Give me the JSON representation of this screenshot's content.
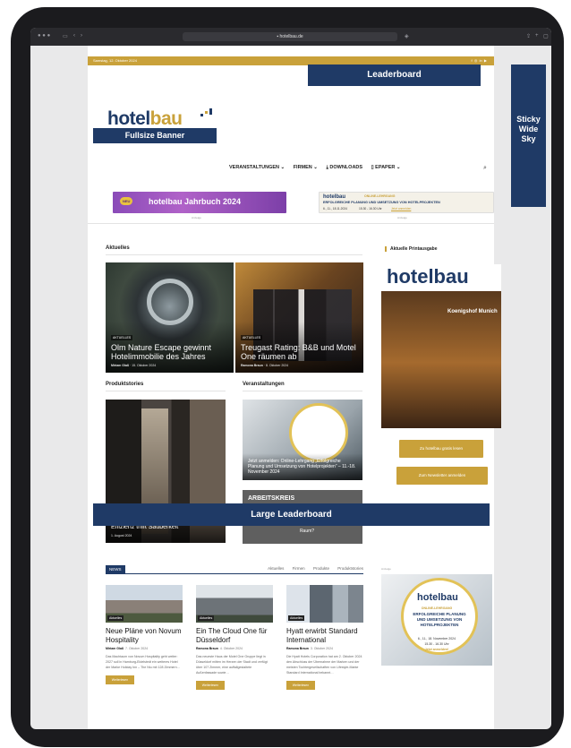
{
  "browser": {
    "url": "hotelbau.de",
    "lock_icon": "lock-icon"
  },
  "topbar": {
    "date": "Samstag, 12. Oktober 2024",
    "icons": [
      "facebook-icon",
      "instagram-icon",
      "linkedin-icon",
      "youtube-icon"
    ]
  },
  "logo": {
    "hotel": "hotel",
    "bau": "bau"
  },
  "ad_labels": {
    "leaderboard": "Leaderboard",
    "sticky": "Sticky\nWide\nSky",
    "fullsize": "Fullsize Banner",
    "large_leaderboard": "Large Leaderboard"
  },
  "menu": {
    "items": [
      "VERANSTALTUNGEN ⌄",
      "FIRMEN ⌄",
      "⤓ DOWNLOADS",
      "▯ EPAPER ⌄"
    ]
  },
  "banners": {
    "jahrbuch": {
      "neu": "NEU",
      "title": "hotelbau Jahrbuch 2024",
      "caption": "Anzeige"
    },
    "online": {
      "brand": "hotelbau",
      "line1": "ONLINE-LEHRGANG",
      "line2": "ERFOLGREICHE PLANUNG UND UMSETZUNG VON HOTELPROJEKTEN",
      "line3": "6., 11., 18.11.2024",
      "line4": "15.30 - 16.30 Uhr",
      "line5": "Jetzt anmelden",
      "caption": "Anzeige"
    }
  },
  "aktuelles": {
    "heading": "Aktuelles",
    "cards": [
      {
        "tag": "AKTUELLES",
        "title": "Olm Nature Escape gewinnt Hotelimmobilie des Jahres",
        "author": "Miriam Glaß",
        "date": "15. Oktober 2024"
      },
      {
        "tag": "AKTUELLES",
        "title": "Treugast Rating: B&B und Motel One räumen ab",
        "author": "Ramona Braun",
        "date": "8. Oktober 2024"
      }
    ]
  },
  "produktstories": {
    "heading": "Produktstories",
    "card": {
      "tag": "ANZEIGE",
      "title": "Effizienz trifft Sauberkeit",
      "date": "1. August 2024"
    }
  },
  "veranstaltungen": {
    "heading": "Veranstaltungen",
    "event": {
      "title": "Jetzt anmelden: Online-Lehrgang „Erfolgreiche Planung und Umsetzung von Hotelprojekten“ – 11.-18. November 2024"
    },
    "arbeitskreis": {
      "logo": "ARBEITSKREIS",
      "text": "Sie befassen sich beruflich mit Hotelimmobilien im deutschsprachigen Raum?"
    }
  },
  "printausgabe": {
    "heading": "Aktuelle Printausgabe",
    "cover_brand": "hotelbau",
    "cover_title": "Koenigshof Munich",
    "btn_read": "Zu hotelbau gratis lesen",
    "btn_newsletter": "Zum Newsletter anmelden"
  },
  "news": {
    "tab": "NEWS",
    "filters": [
      "Aktuelles",
      "Firmen",
      "Produkte",
      "Produktstories"
    ],
    "items": [
      {
        "label": "Aktuelles",
        "title": "Neue Pläne von Novum Hospitality",
        "author": "Miriam Glaß",
        "date": "7. Oktober 2024",
        "excerpt": "Das Machtaum von Novum Hospitality geht weiter: 2027 soll in Hamburg-Eidelstedt ein weiteres Hotel der Marke Holiday Inn – The Niu mit 128 Zimmern…",
        "more": "Weiterlesen"
      },
      {
        "label": "Aktuelles",
        "title": "Ein The Cloud One für Düsseldorf",
        "author": "Ramona Braun",
        "date": "4. Oktober 2024",
        "excerpt": "Das neueste Haus der Motel One Gruppe liegt in Düsseldorf mitten im Herzen der Stadt und verfügt über 107 Zimmer, eine auffallgestaltete Außenfassade sowie…",
        "more": "Weiterlesen"
      },
      {
        "label": "Aktuelles",
        "title": "Hyatt erwirbt Standard International",
        "author": "Ramona Braun",
        "date": "3. Oktober 2024",
        "excerpt": "Die Hyatt Hotels Corporation hat am 2. Oktober 2024 den Abschluss der Übernahme der Marken und der meisten Tochtergesellschaften von Lifestyle-Marke Standard International bekannt…",
        "more": "Weiterlesen"
      }
    ]
  },
  "side_ad": {
    "caption": "Anzeige",
    "brand": "hotelbau",
    "line1": "ONLINE-LEHRGANG",
    "line2": "ERFOLGREICHE PLANUNG UND UMSETZUNG VON HOTELPROJEKTEN",
    "line3": "6., 11., 18. November 2024",
    "line4": "15.30 - 16.30 Uhr",
    "line5": "Jetzt anmelden!"
  },
  "colors": {
    "gold": "#c9a13a",
    "navy": "#1f3a66",
    "device": "#1b1b1e"
  }
}
